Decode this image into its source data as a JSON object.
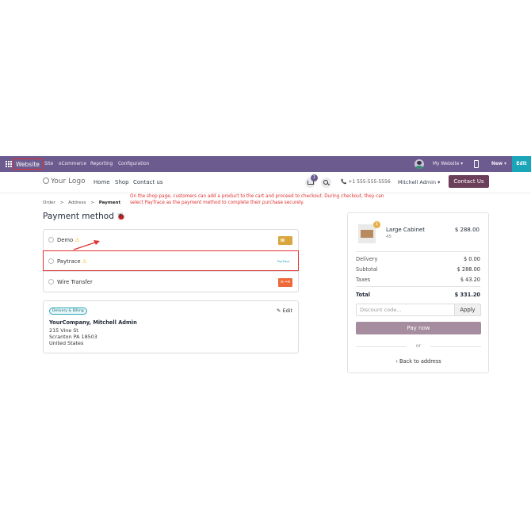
{
  "admin_bar": {
    "website": "Website",
    "menu": [
      "Site",
      "eCommerce",
      "Reporting",
      "Configuration"
    ],
    "my_website": "My Website ▾",
    "new": "New ▾",
    "edit": "Edit"
  },
  "header": {
    "logo": "Your Logo",
    "nav": [
      "Home",
      "Shop",
      "Contact us"
    ],
    "cart_count": "1",
    "phone": "📞  +1 555-555-5556",
    "user": "Mitchell Admin ▾",
    "contact_button": "Contact Us"
  },
  "annotation": "On the shop page, customers can add a product to the cart and proceed to checkout. During checkout, they can select PayTrace as the payment method to complete their purchase securely.",
  "breadcrumb": {
    "order": "Order",
    "sep1": ">",
    "address": "Address",
    "sep2": ">",
    "payment": "Payment"
  },
  "page_title": "Payment method",
  "bug_glyph": "🐞",
  "payment_methods": [
    {
      "label": "Demo",
      "warning": "⚠"
    },
    {
      "label": "Paytrace",
      "warning": "⚠",
      "logo_text": "PayTrace"
    },
    {
      "label": "Wire Transfer",
      "logo_text": "≡→≡"
    }
  ],
  "address_card": {
    "badge": "Delivery & Billing",
    "edit": "✎ Edit",
    "name": "YourCompany, Mitchell Admin",
    "lines": [
      "215 Vine St",
      "Scranton PA 18503",
      "United States"
    ]
  },
  "summary": {
    "product": {
      "name": "Large Cabinet",
      "qty": "1",
      "code": "45",
      "price": "$ 288.00"
    },
    "rows": [
      {
        "label": "Delivery",
        "value": "$ 0.00"
      },
      {
        "label": "Subtotal",
        "value": "$ 288.00"
      },
      {
        "label": "Taxes",
        "value": "$ 43.20"
      }
    ],
    "total": {
      "label": "Total",
      "value": "$ 331.20"
    },
    "discount_placeholder": "Discount code...",
    "apply": "Apply",
    "pay_now": "Pay now",
    "or": "or",
    "back": "‹  Back to address"
  },
  "colors": {
    "admin_bar": "#6b5b8f",
    "highlight": "#e03131",
    "contact_button": "#6b3f5a",
    "pay_now": "#a58d9f",
    "edit_button": "#1aa5b8"
  }
}
